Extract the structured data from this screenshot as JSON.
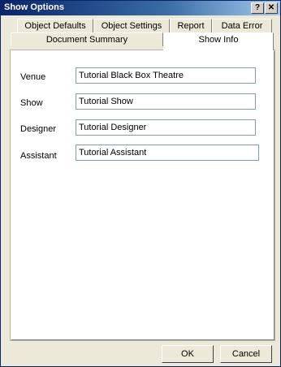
{
  "window": {
    "title": "Show Options",
    "help_label": "?",
    "close_label": "✕"
  },
  "tabs": {
    "object_defaults": "Object Defaults",
    "object_settings": "Object Settings",
    "report": "Report",
    "data_error": "Data Error",
    "document_summary": "Document Summary",
    "show_info": "Show Info"
  },
  "active_tab": "Show Info",
  "fields": {
    "venue": {
      "label": "Venue",
      "value": "Tutorial Black Box Theatre"
    },
    "show": {
      "label": "Show",
      "value": "Tutorial Show"
    },
    "designer": {
      "label": "Designer",
      "value": "Tutorial Designer"
    },
    "assistant": {
      "label": "Assistant",
      "value": "Tutorial Assistant"
    }
  },
  "buttons": {
    "ok": "OK",
    "cancel": "Cancel"
  }
}
